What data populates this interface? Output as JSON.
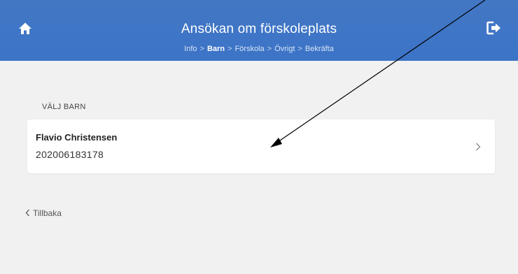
{
  "header": {
    "title": "Ansökan om förskoleplats",
    "breadcrumb": [
      {
        "label": "Info",
        "active": false
      },
      {
        "label": "Barn",
        "active": true
      },
      {
        "label": "Förskola",
        "active": false
      },
      {
        "label": "Övrigt",
        "active": false
      },
      {
        "label": "Bekräfta",
        "active": false
      }
    ],
    "separator": ">",
    "home_icon": "home-icon",
    "logout_icon": "sign-out-icon"
  },
  "section": {
    "label": "VÄLJ BARN"
  },
  "child": {
    "name": "Flavio Christensen",
    "id": "202006183178"
  },
  "back": {
    "label": "Tillbaka"
  },
  "colors": {
    "header_bg": "#4077c6",
    "page_bg": "#f1f1f2",
    "card_bg": "#ffffff"
  }
}
